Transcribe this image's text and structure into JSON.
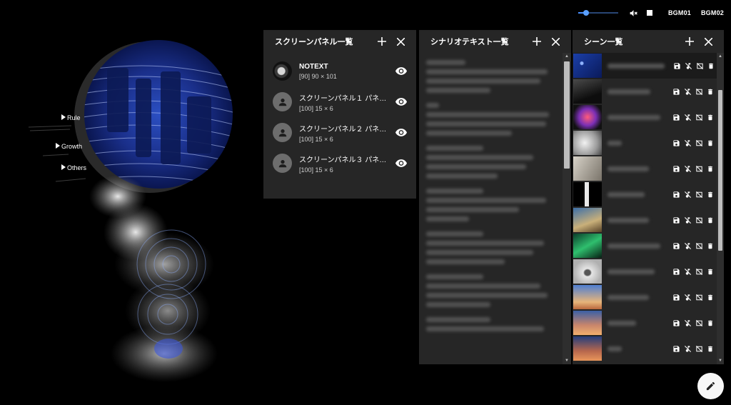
{
  "topbar": {
    "volume_level": 0.2,
    "bgm_buttons": [
      "BGM01",
      "BGM02"
    ]
  },
  "stage": {
    "menu_items": [
      "Rule",
      "Growth",
      "Others"
    ]
  },
  "screen_panels": {
    "title": "スクリーンパネル一覧",
    "items": [
      {
        "name": "NOTEXT",
        "info": "[90] 90 × 101",
        "avatar": "image"
      },
      {
        "name": "スクリーンパネル１ パネル…",
        "info": "[100] 15 × 6",
        "avatar": "person-icon"
      },
      {
        "name": "スクリーンパネル２ パネル…",
        "info": "[100] 15 × 6",
        "avatar": "person-icon"
      },
      {
        "name": "スクリーンパネル３ パネル…",
        "info": "[100] 15 × 6",
        "avatar": "person-icon"
      }
    ]
  },
  "scenario": {
    "title": "シナリオテキスト一覧"
  },
  "scenes": {
    "title": "シーン一覧",
    "thumbnails": [
      "star-trails",
      "dark-room",
      "nebula",
      "flowers",
      "paper",
      "window",
      "books",
      "aurora",
      "eye-sketch",
      "sunset-sky",
      "tower-sunset",
      "tower-dusk"
    ]
  },
  "colors": {
    "panel_bg": "#262626",
    "accent_blue": "#4a8fff"
  }
}
